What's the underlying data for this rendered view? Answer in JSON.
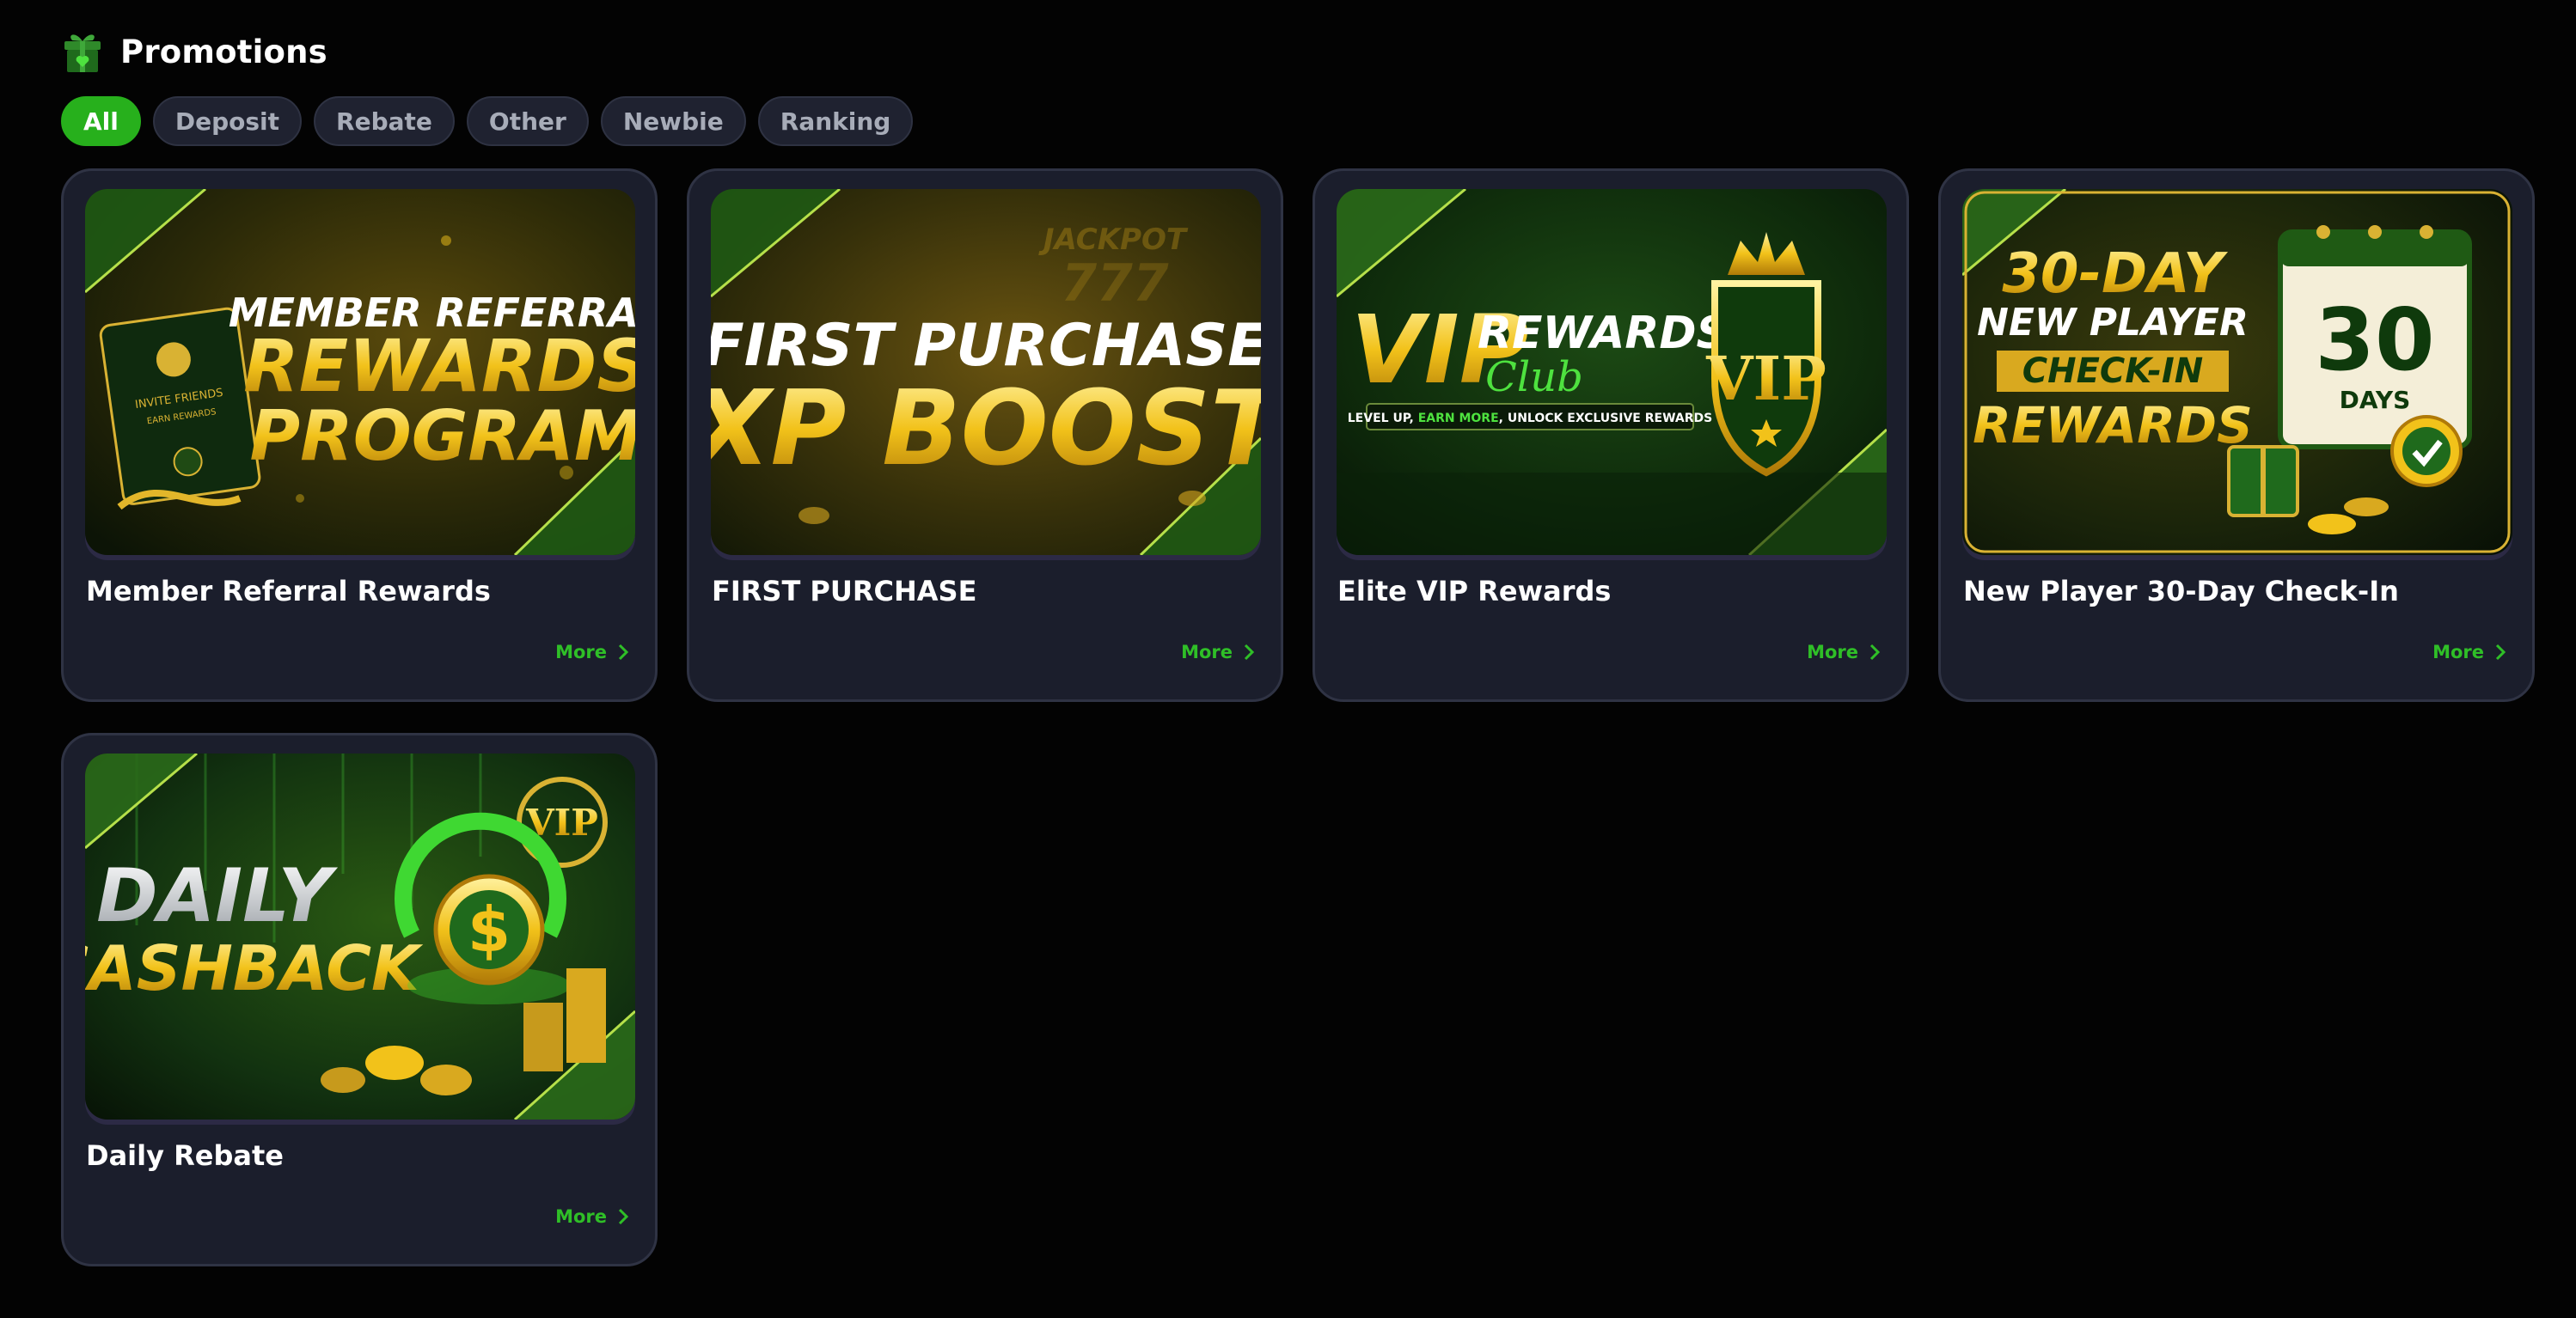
{
  "header": {
    "title": "Promotions",
    "icon": "gift-icon"
  },
  "tabs": [
    {
      "label": "All",
      "active": true
    },
    {
      "label": "Deposit",
      "active": false
    },
    {
      "label": "Rebate",
      "active": false
    },
    {
      "label": "Other",
      "active": false
    },
    {
      "label": "Newbie",
      "active": false
    },
    {
      "label": "Ranking",
      "active": false
    }
  ],
  "colors": {
    "accent": "#27b01c",
    "background": "#030303",
    "card": "#1b1e2c",
    "gold": "#f2c21a",
    "link": "#2fbf27"
  },
  "promotions": [
    {
      "title": "Member Referral Rewards",
      "more": "More",
      "banner": {
        "line1": "MEMBER REFERRAL",
        "line2": "REWARDS",
        "line3": "PROGRAM",
        "card_line1": "INVITE FRIENDS",
        "card_line2": "EARN REWARDS"
      }
    },
    {
      "title": "FIRST PURCHASE",
      "more": "More",
      "banner": {
        "line1": "FIRST PURCHASE",
        "line2": "XP BOOST",
        "bg_text": "JACKPOT",
        "bg_digits": "777"
      }
    },
    {
      "title": "Elite VIP Rewards",
      "more": "More",
      "banner": {
        "vip": "VIP",
        "rewards": "REWARDS",
        "club": "Club",
        "tagline_start": "LEVEL UP, ",
        "tagline_highlight": "EARN MORE",
        "tagline_end": ", UNLOCK EXCLUSIVE REWARDS",
        "shield": "VIP"
      }
    },
    {
      "title": "New Player 30-Day Check-In",
      "more": "More",
      "banner": {
        "line1": "30-DAY",
        "line2": "NEW PLAYER",
        "line3": "CHECK-IN",
        "line4": "REWARDS",
        "cal_number": "30",
        "cal_label": "DAYS"
      }
    },
    {
      "title": "Daily Rebate",
      "more": "More",
      "banner": {
        "line1": "DAILY",
        "line2": "CASHBACK",
        "badge": "VIP",
        "coin": "$"
      }
    }
  ]
}
